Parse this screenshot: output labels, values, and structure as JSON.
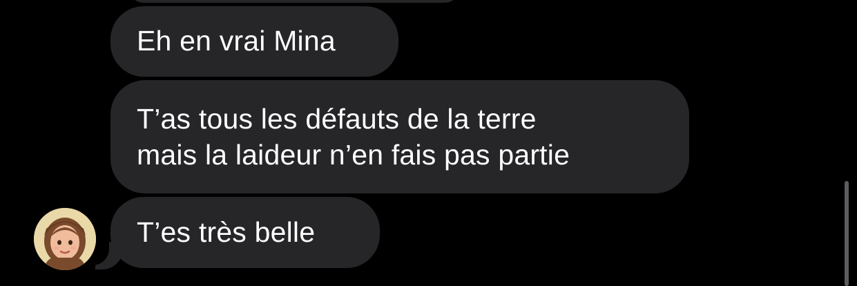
{
  "conversation": {
    "messages": [
      {
        "text": ""
      },
      {
        "text": "Eh en vrai Mina"
      },
      {
        "text": "T’as tous les défauts de la terre\nmais la laideur n’en fais pas partie"
      },
      {
        "text": "T’es très belle"
      }
    ],
    "avatar_icon": "memoji-avatar-icon"
  },
  "colors": {
    "background": "#000000",
    "bubble": "#262629",
    "text": "#ffffff",
    "scrollbar": "#5c5c60"
  }
}
